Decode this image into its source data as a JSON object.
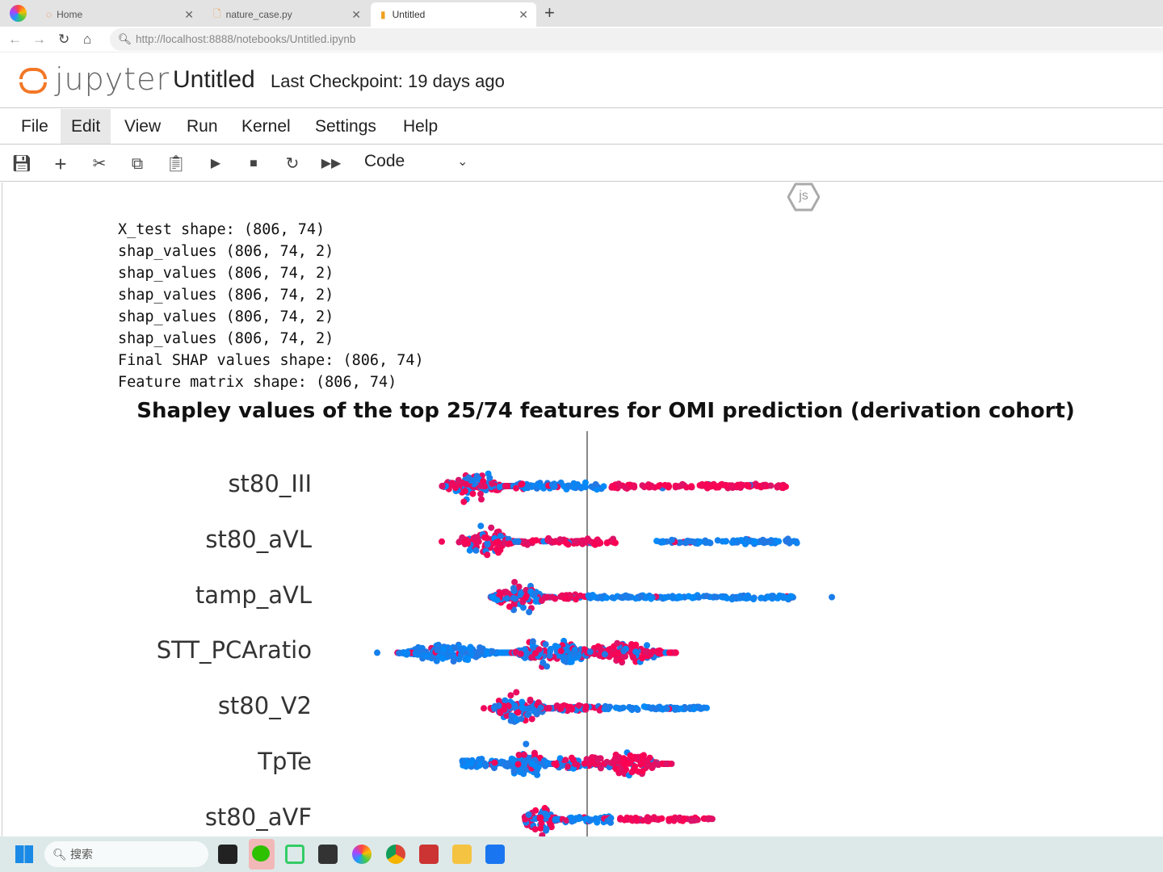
{
  "browser": {
    "tabs": [
      {
        "label": "Home"
      },
      {
        "label": "nature_case.py"
      },
      {
        "label": "Untitled",
        "active": true
      }
    ],
    "url": "http://localhost:8888/notebooks/Untitled.ipynb"
  },
  "jupyter": {
    "logo": "jupyter",
    "title": "Untitled",
    "checkpoint": "Last Checkpoint: 19 days ago",
    "menu": [
      "File",
      "Edit",
      "View",
      "Run",
      "Kernel",
      "Settings",
      "Help"
    ],
    "toolbar": {
      "icons": [
        "save-icon",
        "add-icon",
        "cut-icon",
        "copy-icon",
        "paste-icon",
        "run-icon",
        "stop-icon",
        "restart-icon",
        "fast-forward-icon"
      ],
      "cell_type": "Code"
    },
    "js_badge": "js"
  },
  "output": {
    "lines": [
      "X_test shape: (806, 74)",
      "shap_values (806, 74, 2)",
      "shap_values (806, 74, 2)",
      "shap_values (806, 74, 2)",
      "shap_values (806, 74, 2)",
      "shap_values (806, 74, 2)",
      "Final SHAP values shape: (806, 74)",
      "Feature matrix shape: (806, 74)"
    ]
  },
  "chart_data": {
    "type": "scatter",
    "subtype": "beeswarm",
    "title": "Shapley values of the top 25/74 features for OMI prediction (derivation cohort)",
    "colors": {
      "low": "#008bfb",
      "high": "#ff0051"
    },
    "zero_line": true,
    "features": [
      {
        "name": "st80_III",
        "segments": [
          {
            "from": -1.8,
            "to": -0.9,
            "high": 0.55,
            "spread": 1.0
          },
          {
            "from": -0.9,
            "to": 0.3,
            "high": 0.1,
            "spread": 0.2
          },
          {
            "from": 0.3,
            "to": 2.5,
            "high": 0.95,
            "spread": 0.15
          }
        ]
      },
      {
        "name": "st80_aVL",
        "segments": [
          {
            "from": -1.8,
            "to": -1.8,
            "high": 1,
            "spread": 0
          },
          {
            "from": -1.6,
            "to": -0.8,
            "high": 0.7,
            "spread": 1.0
          },
          {
            "from": -0.8,
            "to": 0.35,
            "high": 0.9,
            "spread": 0.2
          },
          {
            "from": 0.8,
            "to": 2.6,
            "high": 0.05,
            "spread": 0.15
          }
        ]
      },
      {
        "name": "tamp_aVL",
        "segments": [
          {
            "from": -1.2,
            "to": -0.4,
            "high": 0.6,
            "spread": 1.0
          },
          {
            "from": -0.4,
            "to": 0.0,
            "high": 0.9,
            "spread": 0.2
          },
          {
            "from": 0.0,
            "to": 2.6,
            "high": 0.05,
            "spread": 0.12
          },
          {
            "from": 3.03,
            "to": 3.03,
            "high": 0,
            "spread": 0
          }
        ]
      },
      {
        "name": "STT_PCAratio",
        "segments": [
          {
            "from": -2.6,
            "to": -2.6,
            "high": 0,
            "spread": 0
          },
          {
            "from": -2.35,
            "to": -0.9,
            "high": 0.05,
            "spread": 0.6
          },
          {
            "from": -0.9,
            "to": 0.2,
            "high": 0.25,
            "spread": 1.0
          },
          {
            "from": 0.0,
            "to": 1.1,
            "high": 0.85,
            "spread": 0.85
          }
        ]
      },
      {
        "name": "st80_V2",
        "segments": [
          {
            "from": -1.28,
            "to": -1.28,
            "high": 1,
            "spread": 0
          },
          {
            "from": -1.2,
            "to": -0.4,
            "high": 0.55,
            "spread": 1.0
          },
          {
            "from": -0.4,
            "to": 0.2,
            "high": 0.85,
            "spread": 0.2
          },
          {
            "from": 0.2,
            "to": 1.5,
            "high": 0.05,
            "spread": 0.12
          }
        ]
      },
      {
        "name": "TpTe",
        "segments": [
          {
            "from": -1.55,
            "to": -0.9,
            "high": 0.1,
            "spread": 0.3
          },
          {
            "from": -1.0,
            "to": -0.4,
            "high": 0.15,
            "spread": 1.0
          },
          {
            "from": -0.4,
            "to": 0.2,
            "high": 0.45,
            "spread": 0.4
          },
          {
            "from": 0.2,
            "to": 1.05,
            "high": 0.9,
            "spread": 0.8
          }
        ]
      },
      {
        "name": "st80_aVF",
        "segments": [
          {
            "from": -0.8,
            "to": -0.3,
            "high": 0.55,
            "spread": 1.0
          },
          {
            "from": -0.3,
            "to": 0.3,
            "high": 0.2,
            "spread": 0.2
          },
          {
            "from": 0.4,
            "to": 1.6,
            "high": 0.95,
            "spread": 0.15
          }
        ]
      }
    ]
  },
  "taskbar": {
    "search": "搜索",
    "apps": [
      "start",
      "widgets",
      "files-dark",
      "wechat",
      "remote",
      "terminal",
      "browser",
      "chrome",
      "z-app",
      "file-explorer",
      "mail"
    ]
  }
}
